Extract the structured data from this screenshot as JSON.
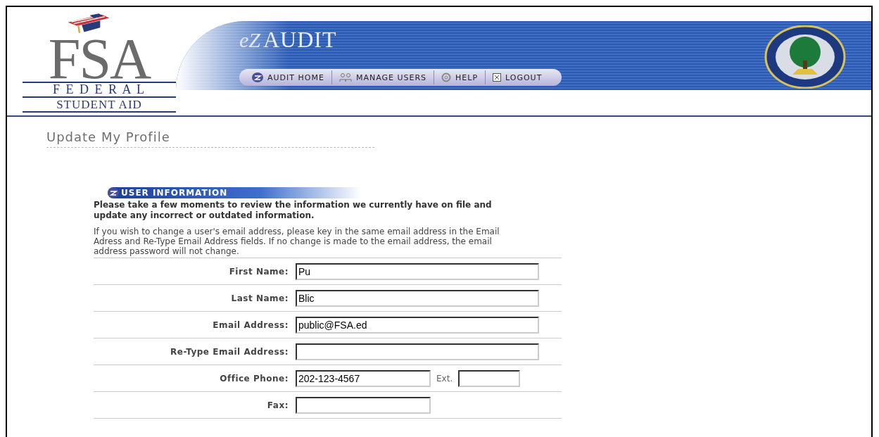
{
  "logo": {
    "letters": "FSA",
    "line_1": "F E D E R A L",
    "line_2": "STUDENT AID"
  },
  "banner": {
    "brand_prefix": "eZ",
    "brand": "AUDIT"
  },
  "nav": [
    {
      "label": "AUDIT HOME"
    },
    {
      "label": "MANAGE USERS"
    },
    {
      "label": "HELP"
    },
    {
      "label": "LOGOUT"
    }
  ],
  "page_title": "Update My Profile",
  "section": {
    "title": "USER INFORMATION",
    "intro": "Please take a few moments to review the information we currently have on file and update any incorrect or outdated information.",
    "note": "If you wish to change a user's email address, please key in the same email address in the Email Adress and Re-Type Email Address fields. If no change is made to the email address, the email address password will not change."
  },
  "fields": [
    {
      "label": "First Name:",
      "value": "Pu",
      "kind": "wide"
    },
    {
      "label": "Last Name:",
      "value": "Blic",
      "kind": "wide"
    },
    {
      "label": "Email Address:",
      "value": "public@FSA.ed",
      "kind": "wide"
    },
    {
      "label": "Re-Type Email Address:",
      "kind": "wide"
    },
    {
      "label": "Office Phone:",
      "value": "202-123-4567",
      "kind": "phone",
      "ext_label": "Ext."
    },
    {
      "label": "Fax:",
      "kind": "short"
    }
  ]
}
